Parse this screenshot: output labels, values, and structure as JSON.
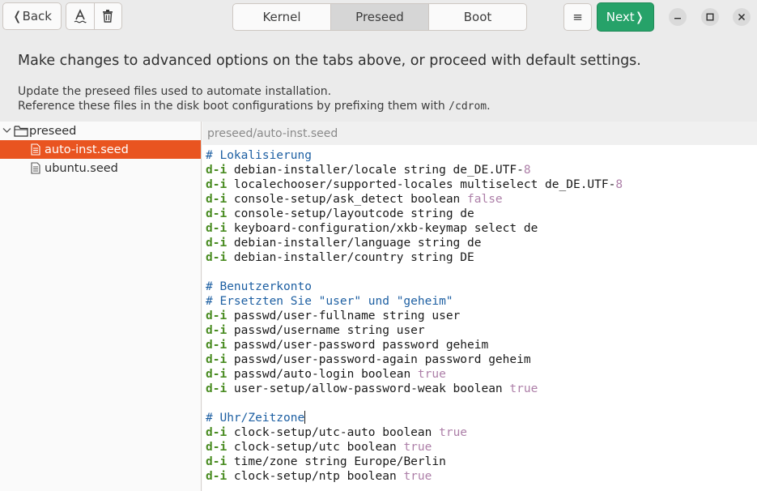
{
  "header": {
    "back_label": "❬Back",
    "tabs": [
      {
        "label": "Kernel",
        "active": false
      },
      {
        "label": "Preseed",
        "active": true
      },
      {
        "label": "Boot",
        "active": false
      }
    ],
    "menu_glyph": "≡",
    "next_label": "Next❭",
    "accent_green": "#26a269"
  },
  "info": {
    "headline": "Make changes to advanced options on the tabs above, or proceed with default settings.",
    "desc_line1": "Update the preseed files used to automate installation.",
    "desc_line2_prefix": "Reference these files in the disk boot configurations by prefixing them with ",
    "desc_line2_code": "/cdrom",
    "desc_line2_suffix": "."
  },
  "tree": {
    "root": "preseed",
    "files": [
      {
        "name": "auto-inst.seed",
        "selected": true
      },
      {
        "name": "ubuntu.seed",
        "selected": false
      }
    ],
    "selection_color": "#e95420"
  },
  "editor": {
    "path": "preseed/auto-inst.seed",
    "lines": [
      {
        "type": "comment",
        "text": "# Lokalisierung"
      },
      {
        "type": "di",
        "text": "debian-installer/locale string de_DE.UTF-",
        "tail": "8",
        "tail_type": "num"
      },
      {
        "type": "di",
        "text": "localechooser/supported-locales multiselect de_DE.UTF-",
        "tail": "8",
        "tail_type": "num"
      },
      {
        "type": "di",
        "text": "console-setup/ask_detect boolean ",
        "tail": "false",
        "tail_type": "bool"
      },
      {
        "type": "di",
        "text": "console-setup/layoutcode string de"
      },
      {
        "type": "di",
        "text": "keyboard-configuration/xkb-keymap select de"
      },
      {
        "type": "di",
        "text": "debian-installer/language string de"
      },
      {
        "type": "di",
        "text": "debian-installer/country string DE"
      },
      {
        "type": "blank",
        "text": ""
      },
      {
        "type": "comment",
        "text": "# Benutzerkonto"
      },
      {
        "type": "comment",
        "text": "# Ersetzten Sie \"user\" und \"geheim\""
      },
      {
        "type": "di",
        "text": "passwd/user-fullname string user"
      },
      {
        "type": "di",
        "text": "passwd/username string user"
      },
      {
        "type": "di",
        "text": "passwd/user-password password geheim"
      },
      {
        "type": "di",
        "text": "passwd/user-password-again password geheim"
      },
      {
        "type": "di",
        "text": "passwd/auto-login boolean ",
        "tail": "true",
        "tail_type": "bool"
      },
      {
        "type": "di",
        "text": "user-setup/allow-password-weak boolean ",
        "tail": "true",
        "tail_type": "bool"
      },
      {
        "type": "blank",
        "text": ""
      },
      {
        "type": "comment",
        "text": "# Uhr/Zeitzone",
        "cursor": true
      },
      {
        "type": "di",
        "text": "clock-setup/utc-auto boolean ",
        "tail": "true",
        "tail_type": "bool"
      },
      {
        "type": "di",
        "text": "clock-setup/utc boolean ",
        "tail": "true",
        "tail_type": "bool"
      },
      {
        "type": "di",
        "text": "time/zone string Europe/Berlin"
      },
      {
        "type": "di",
        "text": "clock-setup/ntp boolean ",
        "tail": "true",
        "tail_type": "bool"
      }
    ],
    "keyword": "d-i",
    "colors": {
      "comment": "#1d5fa2",
      "keyword": "#4a8c22",
      "literal": "#ad7fa8"
    }
  }
}
